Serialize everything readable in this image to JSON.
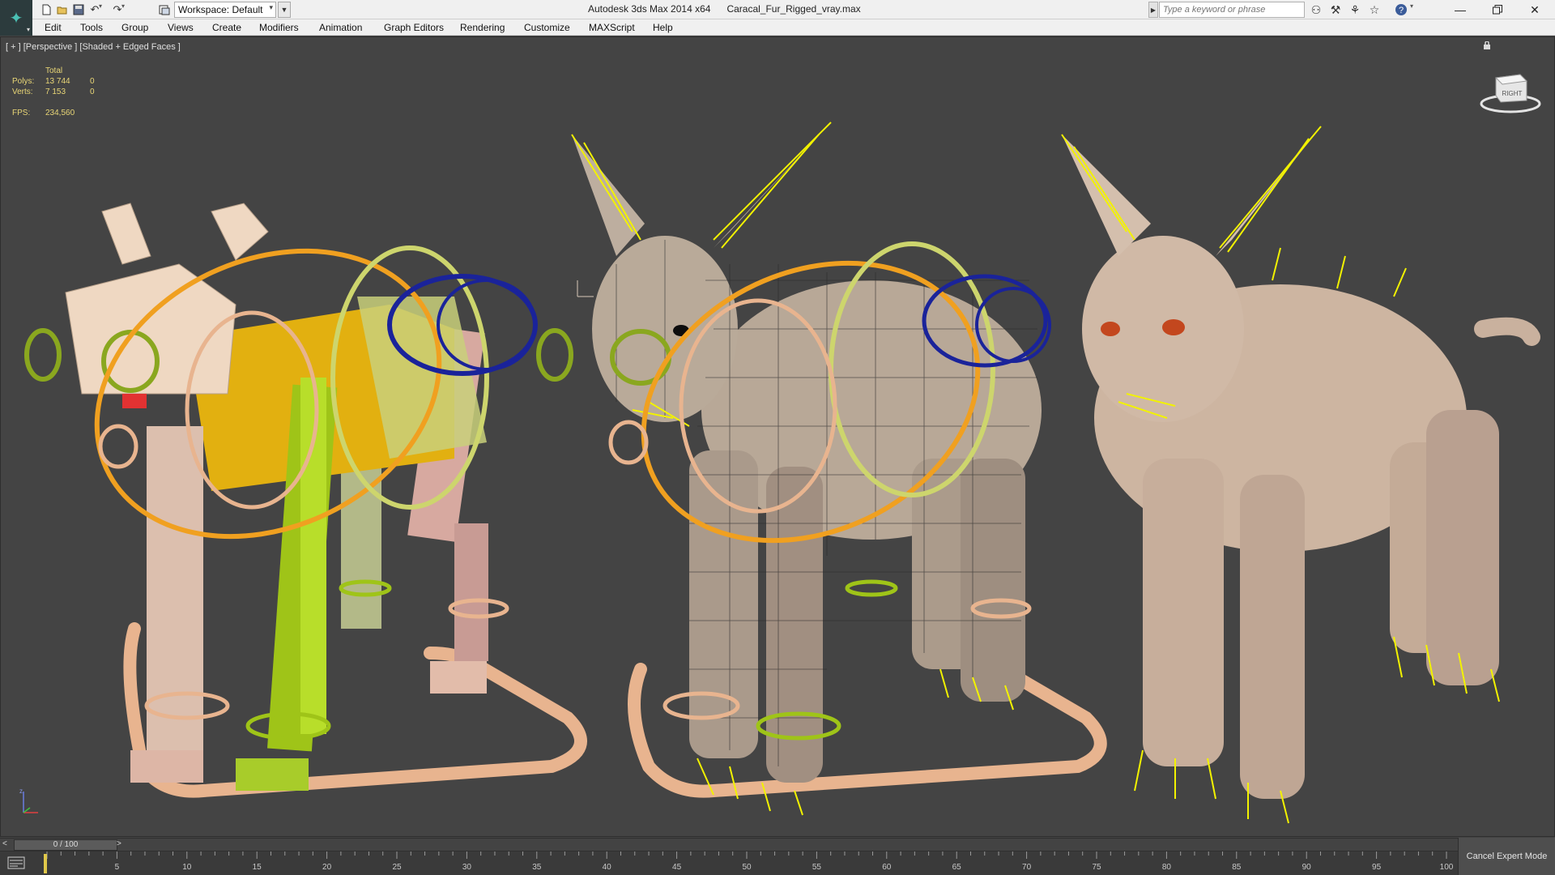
{
  "titlebar": {
    "workspace": "Workspace: Default",
    "app_name": "Autodesk 3ds Max  2014 x64",
    "file_name": "Caracal_Fur_Rigged_vray.max",
    "search_placeholder": "Type a keyword or phrase"
  },
  "menu": [
    {
      "label": "Edit"
    },
    {
      "label": "Tools"
    },
    {
      "label": "Group"
    },
    {
      "label": "Views"
    },
    {
      "label": "Create"
    },
    {
      "label": "Modifiers"
    },
    {
      "label": "Animation"
    },
    {
      "label": "Graph Editors"
    },
    {
      "label": "Rendering"
    },
    {
      "label": "Customize"
    },
    {
      "label": "MAXScript"
    },
    {
      "label": "Help"
    }
  ],
  "viewport": {
    "label": "[ + ] [Perspective ] [Shaded + Edged Faces ]",
    "stats": {
      "header": "Total",
      "polys_label": "Polys:",
      "polys_total": "13 744",
      "polys_sel": "0",
      "verts_label": "Verts:",
      "verts_total": "7 153",
      "verts_sel": "0",
      "fps_label": "FPS:",
      "fps_value": "234,560"
    },
    "viewcube_label": "RIGHT"
  },
  "timeline": {
    "slider_label": "0 / 100",
    "ticks": [
      "5",
      "10",
      "15",
      "20",
      "25",
      "30",
      "35",
      "40",
      "45",
      "50",
      "55",
      "60",
      "65",
      "70",
      "75",
      "80",
      "85",
      "90",
      "95",
      "100"
    ],
    "cancel_expert": "Cancel Expert Mode"
  }
}
